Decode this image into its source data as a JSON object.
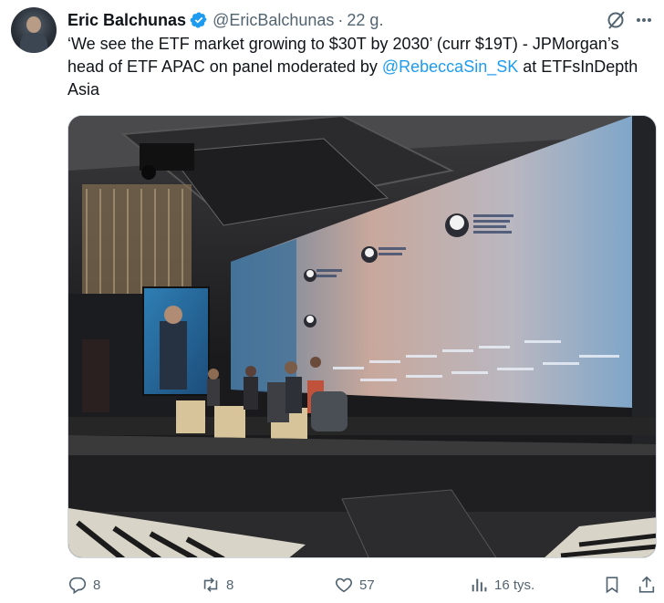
{
  "tweet": {
    "author_name": "Eric Balchunas",
    "handle": "@EricBalchunas",
    "separator": "·",
    "time": "22 g.",
    "text_part1": "‘We see the ETF market growing to $30T by 2030’ (curr $19T) - JPMorgan’s head of ETF APAC on panel moderated by ",
    "mention": "@RebeccaSin_SK",
    "text_part2": " at ETFsInDepth Asia"
  },
  "actions": {
    "replies": "8",
    "reposts": "8",
    "likes": "57",
    "views": "16 tys."
  },
  "icons": [
    "verified-badge-icon",
    "grok-icon",
    "more-icon",
    "reply-icon",
    "repost-icon",
    "like-icon",
    "views-icon",
    "bookmark-icon",
    "share-icon"
  ],
  "colors": {
    "accent": "#1d9bf0",
    "muted": "#536471",
    "text": "#0f1419"
  }
}
